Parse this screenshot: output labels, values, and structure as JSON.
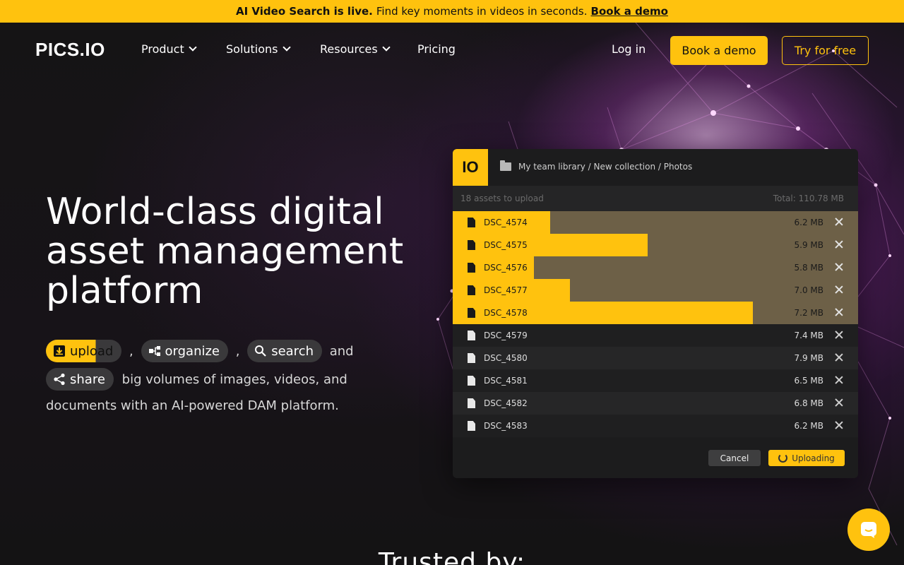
{
  "banner": {
    "bold": "AI Video Search is live.",
    "text": "Find key moments in videos in seconds.",
    "link": "Book a demo"
  },
  "nav": {
    "logo": "PICS.IO",
    "items": [
      {
        "label": "Product",
        "has_dropdown": true
      },
      {
        "label": "Solutions",
        "has_dropdown": true
      },
      {
        "label": "Resources",
        "has_dropdown": true
      },
      {
        "label": "Pricing",
        "has_dropdown": false
      }
    ],
    "login": "Log in",
    "book_demo": "Book a demo",
    "try_free": "Try for free"
  },
  "hero": {
    "headline": "World-class digital asset management platform",
    "pills": {
      "upload": "upload",
      "organize": "organize",
      "search": "search",
      "share": "share"
    },
    "comma": ",",
    "and": "and",
    "desc_line1": "big volumes of images, videos, and",
    "desc_line2": "documents with an AI-powered DAM platform."
  },
  "uploader": {
    "logo": "IO",
    "breadcrumb": "My team library / New collection / Photos",
    "assets_count": "18 assets to upload",
    "total": "Total: 110.78 MB",
    "files": [
      {
        "name": "DSC_4574",
        "size": "6.2 MB",
        "progress": 0.24
      },
      {
        "name": "DSC_4575",
        "size": "5.9 MB",
        "progress": 0.48
      },
      {
        "name": "DSC_4576",
        "size": "5.8 MB",
        "progress": 0.2
      },
      {
        "name": "DSC_4577",
        "size": "7.0 MB",
        "progress": 0.29
      },
      {
        "name": "DSC_4578",
        "size": "7.2 MB",
        "progress": 0.74
      },
      {
        "name": "DSC_4579",
        "size": "7.4 MB",
        "progress": 0
      },
      {
        "name": "DSC_4580",
        "size": "7.9 MB",
        "progress": 0
      },
      {
        "name": "DSC_4581",
        "size": "6.5 MB",
        "progress": 0
      },
      {
        "name": "DSC_4582",
        "size": "6.8 MB",
        "progress": 0
      },
      {
        "name": "DSC_4583",
        "size": "6.2 MB",
        "progress": 0
      }
    ],
    "cancel": "Cancel",
    "uploading": "Uploading"
  },
  "trusted": "Trusted by:",
  "colors": {
    "accent": "#ffc20e",
    "background": "#111112"
  }
}
